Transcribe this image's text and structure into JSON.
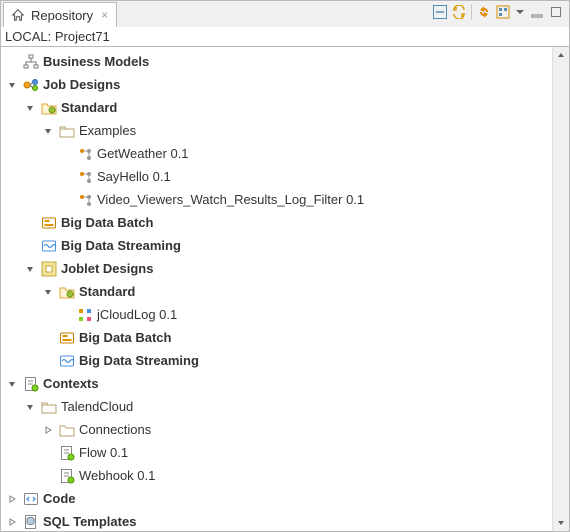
{
  "tab": {
    "title": "Repository"
  },
  "path": "LOCAL: Project71",
  "tree": [
    {
      "indent": 0,
      "twist": null,
      "icon": "biz-models",
      "label": "Business Models",
      "bold": true
    },
    {
      "indent": 0,
      "twist": "expanded",
      "icon": "job-root",
      "label": "Job Designs",
      "bold": true
    },
    {
      "indent": 1,
      "twist": "expanded",
      "icon": "folder-std",
      "label": "Standard",
      "bold": true
    },
    {
      "indent": 2,
      "twist": "expanded",
      "icon": "folder",
      "label": "Examples",
      "bold": false
    },
    {
      "indent": 3,
      "twist": null,
      "icon": "job",
      "label": "GetWeather 0.1",
      "bold": false
    },
    {
      "indent": 3,
      "twist": null,
      "icon": "job",
      "label": "SayHello 0.1",
      "bold": false
    },
    {
      "indent": 3,
      "twist": null,
      "icon": "job",
      "label": "Video_Viewers_Watch_Results_Log_Filter 0.1",
      "bold": false
    },
    {
      "indent": 1,
      "twist": null,
      "icon": "batch",
      "label": "Big Data Batch",
      "bold": true
    },
    {
      "indent": 1,
      "twist": null,
      "icon": "stream",
      "label": "Big Data Streaming",
      "bold": true
    },
    {
      "indent": 1,
      "twist": "expanded",
      "icon": "joblet-root",
      "label": "Joblet Designs",
      "bold": true
    },
    {
      "indent": 2,
      "twist": "expanded",
      "icon": "folder-std",
      "label": "Standard",
      "bold": true
    },
    {
      "indent": 3,
      "twist": null,
      "icon": "joblet",
      "label": "jCloudLog 0.1",
      "bold": false
    },
    {
      "indent": 2,
      "twist": null,
      "icon": "batch",
      "label": "Big Data Batch",
      "bold": true
    },
    {
      "indent": 2,
      "twist": null,
      "icon": "stream",
      "label": "Big Data Streaming",
      "bold": true
    },
    {
      "indent": 0,
      "twist": "expanded",
      "icon": "contexts",
      "label": "Contexts",
      "bold": true
    },
    {
      "indent": 1,
      "twist": "expanded",
      "icon": "folder",
      "label": "TalendCloud",
      "bold": false
    },
    {
      "indent": 2,
      "twist": "collapsed",
      "icon": "folder-closed",
      "label": "Connections",
      "bold": false
    },
    {
      "indent": 2,
      "twist": null,
      "icon": "context",
      "label": "Flow 0.1",
      "bold": false
    },
    {
      "indent": 2,
      "twist": null,
      "icon": "context",
      "label": "Webhook 0.1",
      "bold": false
    },
    {
      "indent": 0,
      "twist": "collapsed",
      "icon": "code",
      "label": "Code",
      "bold": true
    },
    {
      "indent": 0,
      "twist": "collapsed",
      "icon": "sql",
      "label": "SQL Templates",
      "bold": true
    }
  ]
}
